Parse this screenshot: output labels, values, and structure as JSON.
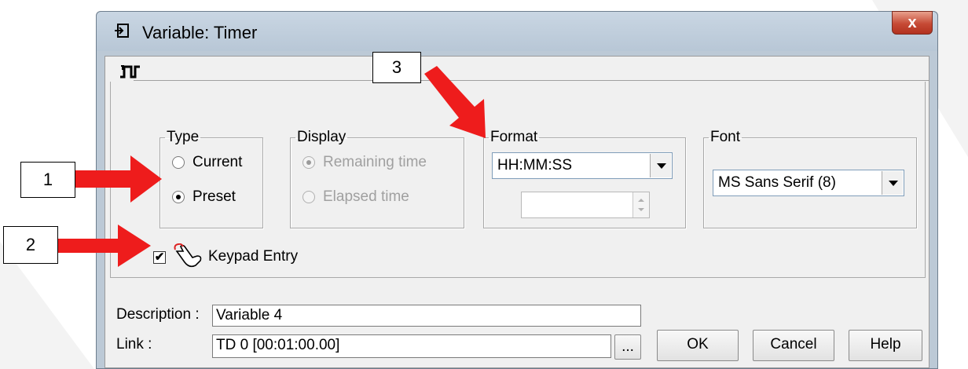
{
  "window": {
    "title": "Variable: Timer",
    "close_label": "x"
  },
  "type_group": {
    "legend": "Type",
    "options": [
      "Current",
      "Preset"
    ],
    "selected": "Preset"
  },
  "display_group": {
    "legend": "Display",
    "options": [
      "Remaining time",
      "Elapsed time"
    ],
    "selected": "Remaining time",
    "disabled": true
  },
  "format_group": {
    "legend": "Format",
    "selected": "HH:MM:SS",
    "spin_value": ""
  },
  "font_group": {
    "legend": "Font",
    "selected": "MS Sans Serif (8)"
  },
  "keypad": {
    "label": "Keypad Entry",
    "checked": true,
    "check_glyph": "✔"
  },
  "description": {
    "label": "Description :",
    "value": "Variable 4"
  },
  "link": {
    "label": "Link  :",
    "value": "TD 0 [00:01:00.00]",
    "browse_label": "..."
  },
  "buttons": {
    "ok": "OK",
    "cancel": "Cancel",
    "help": "Help"
  },
  "annotations": [
    "1",
    "2",
    "3"
  ],
  "colors": {
    "arrow": "#ee1c1c",
    "close": "#c64a35"
  },
  "icons": {
    "title": "window-icon",
    "tab": "timer-pulse-icon",
    "keypad": "keypad-hand-icon"
  }
}
